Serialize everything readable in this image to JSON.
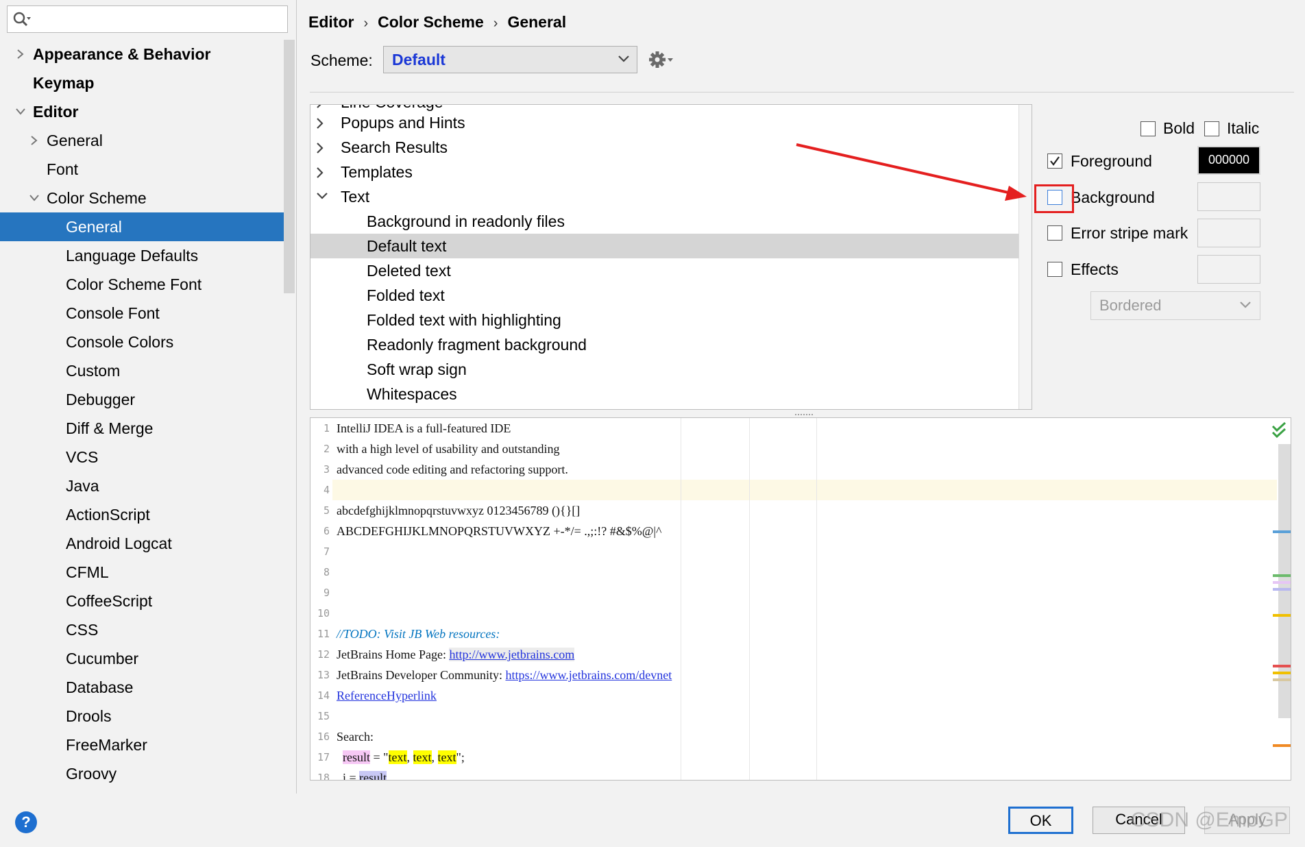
{
  "sidebar": {
    "search": {
      "placeholder": ""
    },
    "items": [
      {
        "label": "Appearance & Behavior",
        "level": 0,
        "arrow": "right",
        "bold": true
      },
      {
        "label": "Keymap",
        "level": 0,
        "arrow": "none",
        "bold": true
      },
      {
        "label": "Editor",
        "level": 0,
        "arrow": "down",
        "bold": true
      },
      {
        "label": "General",
        "level": 1,
        "arrow": "right"
      },
      {
        "label": "Font",
        "level": 1,
        "arrow": "none"
      },
      {
        "label": "Color Scheme",
        "level": 1,
        "arrow": "down"
      },
      {
        "label": "General",
        "level": 2,
        "arrow": "none",
        "selected": true
      },
      {
        "label": "Language Defaults",
        "level": 2,
        "arrow": "none"
      },
      {
        "label": "Color Scheme Font",
        "level": 2,
        "arrow": "none"
      },
      {
        "label": "Console Font",
        "level": 2,
        "arrow": "none"
      },
      {
        "label": "Console Colors",
        "level": 2,
        "arrow": "none"
      },
      {
        "label": "Custom",
        "level": 2,
        "arrow": "none"
      },
      {
        "label": "Debugger",
        "level": 2,
        "arrow": "none"
      },
      {
        "label": "Diff & Merge",
        "level": 2,
        "arrow": "none"
      },
      {
        "label": "VCS",
        "level": 2,
        "arrow": "none"
      },
      {
        "label": "Java",
        "level": 2,
        "arrow": "none"
      },
      {
        "label": "ActionScript",
        "level": 2,
        "arrow": "none"
      },
      {
        "label": "Android Logcat",
        "level": 2,
        "arrow": "none"
      },
      {
        "label": "CFML",
        "level": 2,
        "arrow": "none"
      },
      {
        "label": "CoffeeScript",
        "level": 2,
        "arrow": "none"
      },
      {
        "label": "CSS",
        "level": 2,
        "arrow": "none"
      },
      {
        "label": "Cucumber",
        "level": 2,
        "arrow": "none"
      },
      {
        "label": "Database",
        "level": 2,
        "arrow": "none"
      },
      {
        "label": "Drools",
        "level": 2,
        "arrow": "none"
      },
      {
        "label": "FreeMarker",
        "level": 2,
        "arrow": "none"
      },
      {
        "label": "Groovy",
        "level": 2,
        "arrow": "none"
      }
    ]
  },
  "breadcrumb": {
    "part1": "Editor",
    "part2": "Color Scheme",
    "part3": "General",
    "separator": "›"
  },
  "scheme": {
    "label": "Scheme:",
    "value": "Default"
  },
  "attributes": {
    "cut_label": "Line Coverage",
    "items": [
      {
        "label": "Popups and Hints",
        "arrow": "right",
        "level": 0
      },
      {
        "label": "Search Results",
        "arrow": "right",
        "level": 0
      },
      {
        "label": "Templates",
        "arrow": "right",
        "level": 0
      },
      {
        "label": "Text",
        "arrow": "down",
        "level": 0
      },
      {
        "label": "Background in readonly files",
        "level": 1
      },
      {
        "label": "Default text",
        "level": 1,
        "selected": true
      },
      {
        "label": "Deleted text",
        "level": 1
      },
      {
        "label": "Folded text",
        "level": 1
      },
      {
        "label": "Folded text with highlighting",
        "level": 1
      },
      {
        "label": "Readonly fragment background",
        "level": 1
      },
      {
        "label": "Soft wrap sign",
        "level": 1
      },
      {
        "label": "Whitespaces",
        "level": 1
      }
    ]
  },
  "options": {
    "bold_label": "Bold",
    "italic_label": "Italic",
    "foreground_label": "Foreground",
    "foreground_checked": true,
    "foreground_value": "000000",
    "background_label": "Background",
    "background_checked": false,
    "error_stripe_label": "Error stripe mark",
    "effects_label": "Effects",
    "effects_type": "Bordered"
  },
  "preview": {
    "line_numbers": [
      "1",
      "2",
      "3",
      "4",
      "5",
      "6",
      "7",
      "8",
      "9",
      "10",
      "11",
      "12",
      "13",
      "14",
      "15",
      "16",
      "17",
      "18"
    ],
    "lines": {
      "l1": "IntelliJ IDEA is a full-featured IDE",
      "l2": "with a high level of usability and outstanding",
      "l3": "advanced code editing and refactoring support.",
      "l5": "abcdefghijklmnopqrstuvwxyz 0123456789 (){}[]",
      "l6": "ABCDEFGHIJKLMNOPQRSTUVWXYZ +-*/= .,;:!? #&$%@|^",
      "l11": "//TODO: Visit JB Web resources:",
      "l12_prefix": "JetBrains Home Page: ",
      "l12_link": "http://www.jetbrains.com",
      "l13_prefix": "JetBrains Developer Community: ",
      "l13_link": "https://www.jetbrains.com/devnet",
      "l14_link": "ReferenceHyperlink",
      "l16": "Search:",
      "l17_indent": "  ",
      "l17_var": "result",
      "l17_eq": " = \"",
      "l17_t1": "text",
      "l17_c1": ", ",
      "l17_t2": "text",
      "l17_c2": ", ",
      "l17_t3": "text",
      "l17_end": "\";",
      "l18_indent": "  ",
      "l18_var": "i",
      "l18_eq": " = ",
      "l18_ref": "result"
    }
  },
  "buttons": {
    "ok": "OK",
    "cancel": "Cancel",
    "apply": "Apply",
    "help": "?"
  },
  "watermark": "CSDN @EmoGP",
  "colors": {
    "selection": "#2675bf",
    "accent_blue": "#1e6fd0",
    "scheme_text": "#1a37d6",
    "annotation_red": "#e41f1f"
  }
}
